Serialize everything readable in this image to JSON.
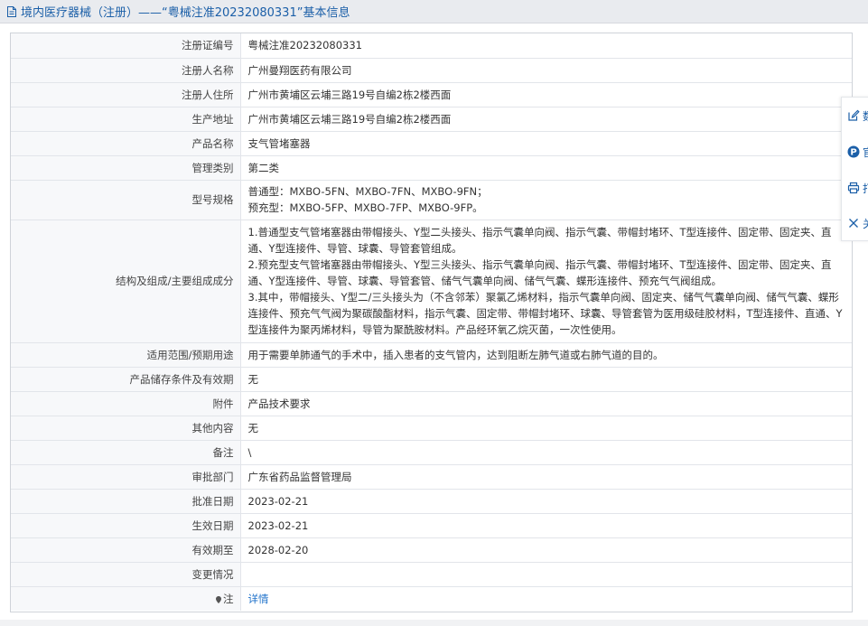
{
  "header": {
    "title": "境内医疗器械（注册）——“粤械注准20232080331”基本信息"
  },
  "rows": [
    {
      "label": "注册证编号",
      "value": "粤械注准20232080331"
    },
    {
      "label": "注册人名称",
      "value": "广州曼翔医药有限公司"
    },
    {
      "label": "注册人住所",
      "value": "广州市黄埔区云埔三路19号自编2栋2楼西面"
    },
    {
      "label": "生产地址",
      "value": "广州市黄埔区云埔三路19号自编2栋2楼西面"
    },
    {
      "label": "产品名称",
      "value": "支气管堵塞器"
    },
    {
      "label": "管理类别",
      "value": "第二类"
    },
    {
      "label": "型号规格",
      "value": "普通型：MXBO-5FN、MXBO-7FN、MXBO-9FN；\n预充型：MXBO-5FP、MXBO-7FP、MXBO-9FP。"
    },
    {
      "label": "结构及组成/主要组成成分",
      "value": "1.普通型支气管堵塞器由带帽接头、Y型二头接头、指示气囊单向阀、指示气囊、带帽封堵环、T型连接件、固定带、固定夹、直通、Y型连接件、导管、球囊、导管套管组成。\n2.预充型支气管堵塞器由带帽接头、Y型三头接头、指示气囊单向阀、指示气囊、带帽封堵环、T型连接件、固定带、固定夹、直通、Y型连接件、导管、球囊、导管套管、储气气囊单向阀、储气气囊、蝶形连接件、预充气气阀组成。\n3.其中，带帽接头、Y型二/三头接头为（不含邻苯）聚氯乙烯材料，指示气囊单向阀、固定夹、储气气囊单向阀、储气气囊、蝶形连接件、预充气气阀为聚碳酸酯材料，指示气囊、固定带、带帽封堵环、球囊、导管套管为医用级硅胶材料，T型连接件、直通、Y型连接件为聚丙烯材料，导管为聚酰胺材料。产品经环氧乙烷灭菌，一次性使用。"
    },
    {
      "label": "适用范围/预期用途",
      "value": "用于需要单肺通气的手术中，插入患者的支气管内，达到阻断左肺气道或右肺气道的目的。"
    },
    {
      "label": "产品储存条件及有效期",
      "value": "无"
    },
    {
      "label": "附件",
      "value": "产品技术要求"
    },
    {
      "label": "其他内容",
      "value": "无"
    },
    {
      "label": "备注",
      "value": "\\"
    },
    {
      "label": "审批部门",
      "value": "广东省药品监督管理局"
    },
    {
      "label": "批准日期",
      "value": "2023-02-21"
    },
    {
      "label": "生效日期",
      "value": "2023-02-21"
    },
    {
      "label": "有效期至",
      "value": "2028-02-20"
    },
    {
      "label": "变更情况",
      "value": ""
    }
  ],
  "note_row": {
    "label": "注",
    "link": "详情"
  },
  "side_tools": [
    {
      "label": "数",
      "icon": "edit-icon"
    },
    {
      "label": "官",
      "icon": "help-badge-icon"
    },
    {
      "label": "打",
      "icon": "print-icon"
    },
    {
      "label": "关",
      "icon": "close-icon"
    }
  ],
  "colors": {
    "header_text": "#1b5fa8",
    "link": "#1b6fc9",
    "label_bg": "#f7f8fa",
    "title_bg": "#e9ebef"
  }
}
